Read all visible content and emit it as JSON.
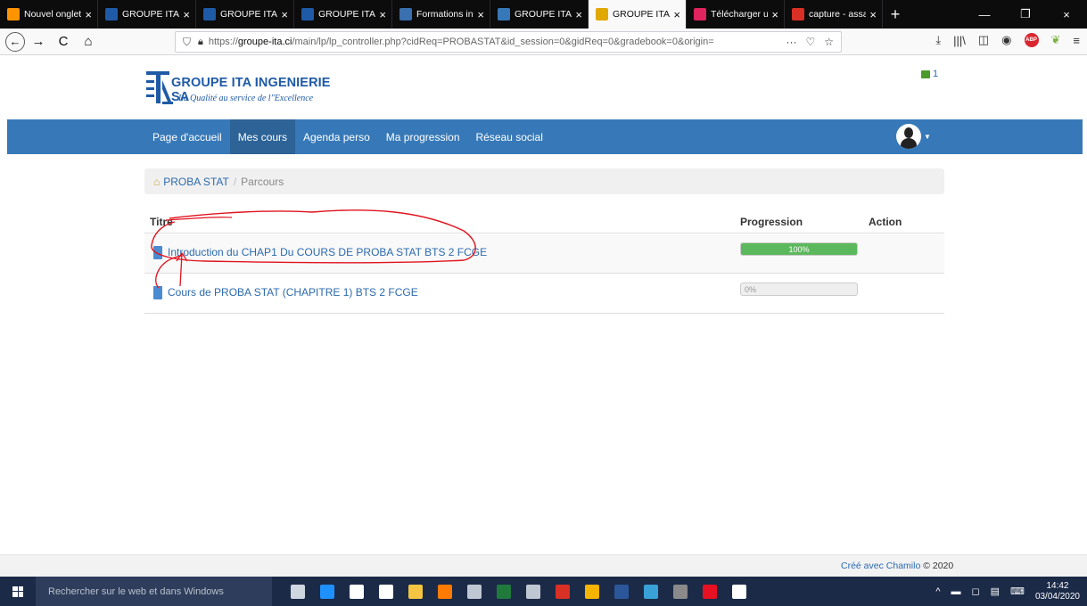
{
  "browser": {
    "tabs": [
      {
        "label": "Nouvel onglet",
        "favicon_color": "#ff9400",
        "active": false
      },
      {
        "label": "GROUPE ITA-INGE",
        "favicon_color": "#1f5aa6",
        "active": false
      },
      {
        "label": "GROUPE ITA-INGE",
        "favicon_color": "#1f5aa6",
        "active": false
      },
      {
        "label": "GROUPE ITA-INGE",
        "favicon_color": "#1f5aa6",
        "active": false
      },
      {
        "label": "Formations infor",
        "favicon_color": "#3a6fb0",
        "active": false
      },
      {
        "label": "GROUPE ITA-INGE",
        "favicon_color": "#3779b8",
        "active": false
      },
      {
        "label": "GROUPE ITA-INGE",
        "favicon_color": "#e0a800",
        "active": true
      },
      {
        "label": "Télécharger un li",
        "favicon_color": "#e0245e",
        "active": false
      },
      {
        "label": "capture - assanc",
        "favicon_color": "#d93025",
        "active": false
      }
    ],
    "close_glyph": "×",
    "new_tab_glyph": "+",
    "window_controls": [
      "—",
      "❐",
      "×"
    ],
    "nav": {
      "back": "←",
      "forward": "→",
      "reload": "C",
      "home": "⌂"
    },
    "url_prefix": "https://",
    "url_domain": "groupe-ita.ci",
    "url_path": "/main/lp/lp_controller.php?cidReq=PROBASTAT&id_session=0&gidReq=0&gradebook=0&origin=",
    "url_icons": [
      "···",
      "♡",
      "☆"
    ],
    "toolbar_icons": [
      "⤓",
      "|||\\",
      "◫",
      "◉"
    ],
    "abp_label": "ABP"
  },
  "header": {
    "brand": "GROUPE ITA INGENIERIE SA",
    "slogan": "La Qualité au service de l\"Excellence",
    "notification_count": "1"
  },
  "menu": [
    {
      "label": "Page d'accueil",
      "active": false
    },
    {
      "label": "Mes cours",
      "active": true
    },
    {
      "label": "Agenda perso",
      "active": false
    },
    {
      "label": "Ma progression",
      "active": false
    },
    {
      "label": "Réseau social",
      "active": false
    }
  ],
  "breadcrumb": {
    "course": "PROBA STAT",
    "separator": "/",
    "current": "Parcours"
  },
  "table": {
    "headers": {
      "title": "Titre",
      "progress": "Progression",
      "action": "Action"
    },
    "rows": [
      {
        "title": "Introduction du CHAP1 Du COURS DE PROBA STAT BTS 2 FCGE",
        "progress": 1.0,
        "progress_label": "100%"
      },
      {
        "title": "Cours de PROBA STAT (CHAPITRE 1) BTS 2 FCGE",
        "progress": 0.0,
        "progress_label": "0%"
      }
    ]
  },
  "footer": {
    "credit_prefix": "Créé avec",
    "credit_link": "Chamilo",
    "credit_suffix": "© 2020"
  },
  "taskbar": {
    "search_placeholder": "Rechercher sur le web et dans Windows",
    "apps": [
      "#cfd6e0",
      "#1e90ff",
      "#ffffff",
      "#ffffff",
      "#f4c542",
      "#ff7b00",
      "#bfc7d2",
      "#1f7a3c",
      "#bfc7d2",
      "#d93025",
      "#f4b400",
      "#2b579a",
      "#3aa0d8",
      "#8a8a8a",
      "#e81123",
      "#ffffff"
    ],
    "tray_icons": [
      "^",
      "▬",
      "◻",
      "▤",
      "⌨"
    ],
    "time": "14:42",
    "date": "03/04/2020"
  },
  "colors": {
    "brand_blue": "#1f5aa6",
    "menu_blue": "#3779b8",
    "progress_green": "#5cb85c",
    "annotation_red": "#e0141e"
  }
}
